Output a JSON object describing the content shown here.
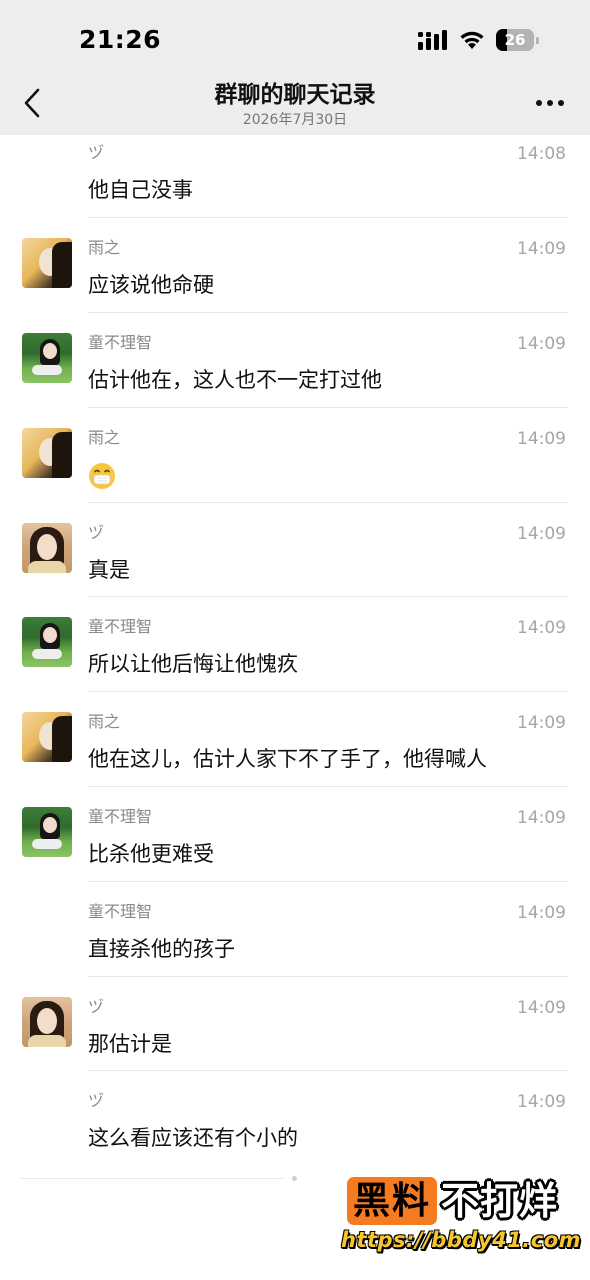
{
  "status_bar": {
    "time": "21:26",
    "battery_level": "26",
    "battery_fraction": 0.26
  },
  "header": {
    "title": "群聊的聊天记录",
    "date": "2026年7月30日",
    "back_icon": "chevron-left-icon",
    "more_icon": "more-horizontal-icon"
  },
  "messages": [
    {
      "sender": "ヅ",
      "time": "14:08",
      "text": "他自己没事",
      "avatar": ""
    },
    {
      "sender": "雨之",
      "time": "14:09",
      "text": "应该说他命硬",
      "avatar": "yuzhi"
    },
    {
      "sender": "童不理智",
      "time": "14:09",
      "text": "估计他在，这人也不一定打过他",
      "avatar": "tong"
    },
    {
      "sender": "雨之",
      "time": "14:09",
      "text": "",
      "emoji": "mask-face-emoji",
      "avatar": "yuzhi"
    },
    {
      "sender": "ヅ",
      "time": "14:09",
      "text": "真是",
      "avatar": "zu"
    },
    {
      "sender": "童不理智",
      "time": "14:09",
      "text": "所以让他后悔让他愧疚",
      "avatar": "tong"
    },
    {
      "sender": "雨之",
      "time": "14:09",
      "text": "他在这儿，估计人家下不了手了，他得喊人",
      "avatar": "yuzhi"
    },
    {
      "sender": "童不理智",
      "time": "14:09",
      "text": "比杀他更难受",
      "avatar": "tong"
    },
    {
      "sender": "童不理智",
      "time": "14:09",
      "text": "直接杀他的孩子",
      "avatar": ""
    },
    {
      "sender": "ヅ",
      "time": "14:09",
      "text": "那估计是",
      "avatar": "zu"
    },
    {
      "sender": "ヅ",
      "time": "14:09",
      "text": "这么看应该还有个小的",
      "avatar": ""
    }
  ],
  "watermark": {
    "brand_highlight": "黑料",
    "brand_rest": "不打烊",
    "url": "https://bbdy41.com",
    "accent_color": "#f47b20"
  },
  "colors": {
    "header_bg": "#ededed",
    "name_gray": "#8a8a8a",
    "time_gray": "#a6a6a6"
  }
}
